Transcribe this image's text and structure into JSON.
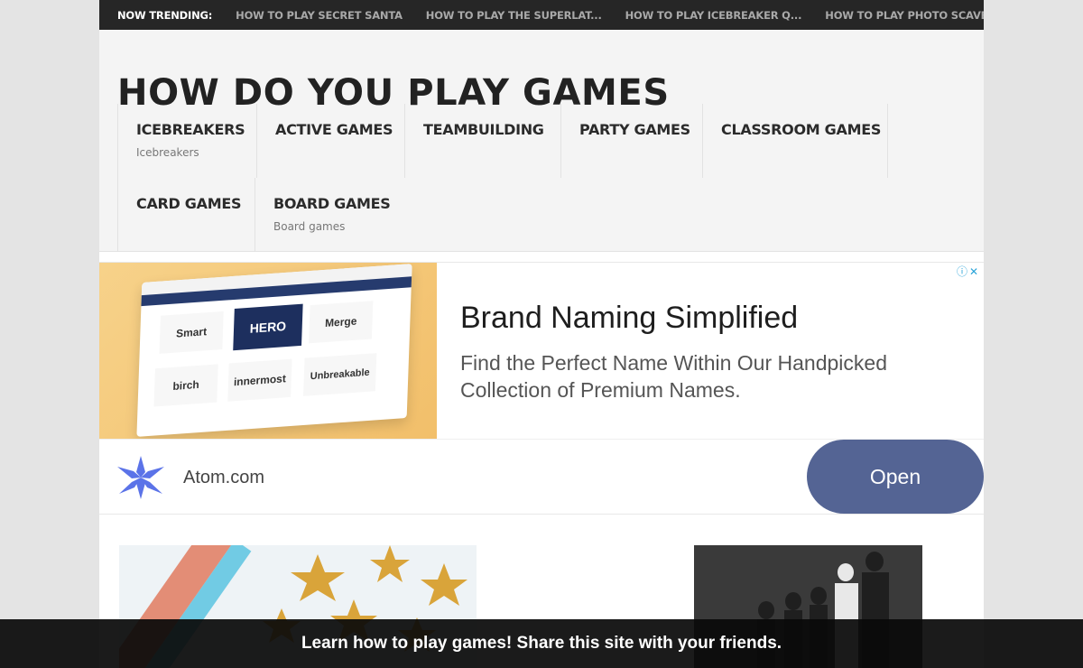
{
  "trending": {
    "label": "NOW TRENDING:",
    "items": [
      "HOW TO PLAY SECRET SANTA",
      "HOW TO PLAY THE SUPERLAT...",
      "HOW TO PLAY ICEBREAKER Q...",
      "HOW TO PLAY PHOTO SCAVEN..."
    ]
  },
  "site": {
    "title": "HOW DO YOU PLAY GAMES"
  },
  "nav": {
    "row1": [
      {
        "label": "ICEBREAKERS",
        "sub": "Icebreakers"
      },
      {
        "label": "ACTIVE GAMES",
        "sub": ""
      },
      {
        "label": "TEAMBUILDING",
        "sub": ""
      },
      {
        "label": "PARTY GAMES",
        "sub": ""
      },
      {
        "label": "CLASSROOM GAMES",
        "sub": ""
      }
    ],
    "row2": [
      {
        "label": "CARD GAMES",
        "sub": ""
      },
      {
        "label": "BOARD GAMES",
        "sub": "Board games"
      }
    ]
  },
  "ad": {
    "headline": "Brand Naming Simplified",
    "body": "Find the Perfect Name Within Our Handpicked Collection of Premium Names.",
    "domain": "Atom.com",
    "cta": "Open",
    "close_icons": "ⓘ✕",
    "brands": [
      "Smart",
      "HERO",
      "Merge",
      "birch",
      "innermost",
      "Unbreakable"
    ],
    "colors": {
      "cta_bg": "#546494",
      "logo": "#5b73e8"
    }
  },
  "banner": {
    "text": "Learn how to play games! Share this site with your friends."
  }
}
